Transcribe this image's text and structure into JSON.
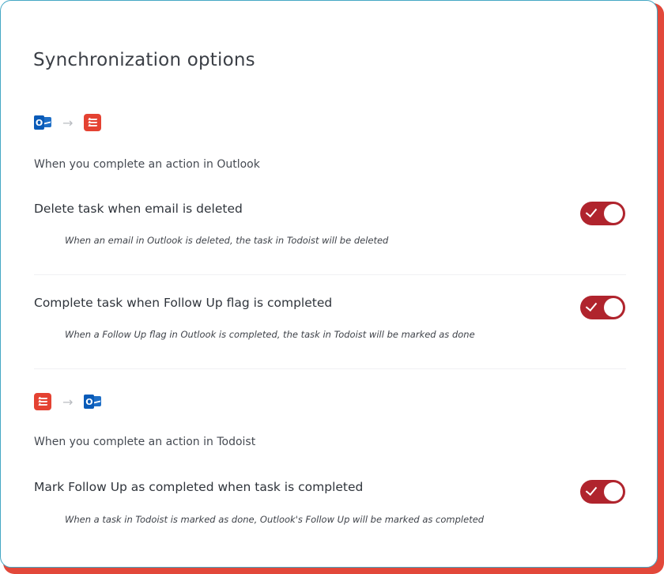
{
  "colors": {
    "accent": "#b0242d",
    "outlook_blue": "#0a5bb8",
    "todoist_red": "#e44232",
    "card_border": "#45a7c4",
    "card_shadow": "#e2483a"
  },
  "title": "Synchronization options",
  "sections": [
    {
      "from_icon": "outlook-icon",
      "to_icon": "todoist-icon",
      "arrow": "→",
      "outlook_letter": "O",
      "heading": "When you complete an action in Outlook",
      "options": [
        {
          "label": "Delete task when email is deleted",
          "description": "When an email in Outlook is deleted, the task in Todoist will be deleted",
          "enabled": true
        },
        {
          "label": "Complete task when Follow Up flag is completed",
          "description": "When a Follow Up flag in Outlook is completed, the task in Todoist will be marked as done",
          "enabled": true
        }
      ]
    },
    {
      "from_icon": "todoist-icon",
      "to_icon": "outlook-icon",
      "arrow": "→",
      "outlook_letter": "O",
      "heading": "When you complete an action in Todoist",
      "options": [
        {
          "label": "Mark Follow Up as completed when task is completed",
          "description": "When a task in Todoist is marked as done, Outlook's Follow Up will be marked as completed",
          "enabled": true
        }
      ]
    }
  ]
}
